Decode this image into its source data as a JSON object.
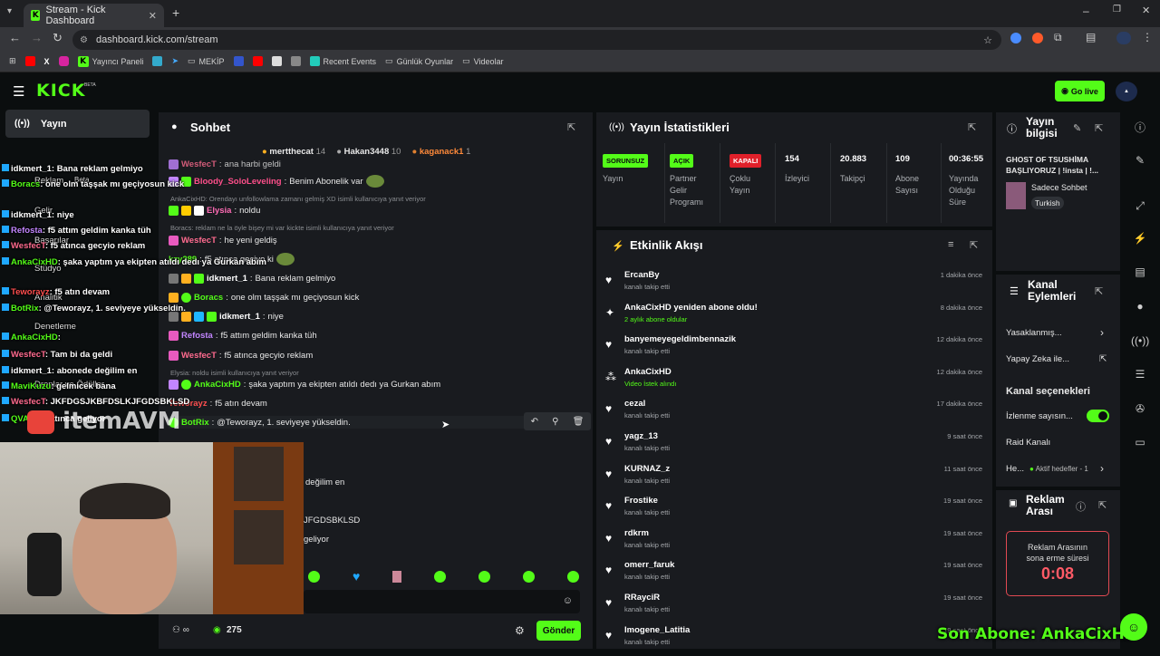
{
  "browser": {
    "tab_title": "Stream - Kick Dashboard",
    "url": "dashboard.kick.com/stream",
    "bookmarks": [
      "Yayıncı Paneli",
      "MEKİP",
      "Recent Events",
      "Günlük Oyunlar",
      "Videolar"
    ]
  },
  "header": {
    "logo": "KICK",
    "logo_badge": "BETA",
    "go_live": "Go live"
  },
  "left_nav": {
    "active_item": "Yayın"
  },
  "chat": {
    "title": "Sohbet",
    "top_gifters": [
      {
        "name": "mertthecat",
        "count": "14"
      },
      {
        "name": "Hakan3448",
        "count": "10"
      },
      {
        "name": "kaganack1",
        "count": "1"
      }
    ],
    "messages": [
      {
        "user": "WesfecT",
        "color": "#ff6b8f",
        "text": "ana harbi geldi"
      },
      {
        "user": "Bloody_SoloLeveling",
        "color": "#ff4f8b",
        "text": "Benim Abonelik var"
      },
      {
        "reply": "AnkaCixHD: Orendayı unfollowlama zamanı gelmiş XD isimli kullanıcıya yanıt veriyor"
      },
      {
        "user": "Elysia",
        "color": "#ff6bb5",
        "text": "noldu"
      },
      {
        "reply": "Boracs: reklam ne la öyle bişey mi var kickte isimli kullanıcıya yanıt veriyor"
      },
      {
        "user": "WesfecT",
        "color": "#ff6b8f",
        "text": "he yeni geldiş"
      },
      {
        "user": "kzy289",
        "color": "#53fc18",
        "text": "f5 atınca geçiyo ki"
      },
      {
        "user": "idkmert_1",
        "color": "#ffffff",
        "text": "Bana reklam gelmiyo"
      },
      {
        "user": "Boracs",
        "color": "#53fc18",
        "text": "one olm taşşak mı geçiyosun kick"
      },
      {
        "user": "idkmert_1",
        "color": "#ffffff",
        "text": "niye"
      },
      {
        "user": "Refosta",
        "color": "#c285ff",
        "text": "f5 attım geldim kanka tüh"
      },
      {
        "user": "WesfecT",
        "color": "#ff6b8f",
        "text": "f5 atınca gecyio reklam"
      },
      {
        "reply": "Elysia: noldu isimli kullanıcıya yanıt veriyor"
      },
      {
        "user": "AnkaCixHD",
        "color": "#53fc18",
        "text": "şaka yaptım ya ekipten atıldı dedı ya Gurkan abım"
      },
      {
        "user": "Teworayz",
        "color": "#ff4f4f",
        "text": "f5 atın devam"
      },
      {
        "user": "BotRix",
        "color": "#53fc18",
        "text": "@Teworayz, 1. seviyeye yükseldin."
      }
    ],
    "partial_messages": [
      "değilim en",
      "JFGDSBKLSD",
      "geliyor"
    ],
    "footer_count": "275",
    "send_label": "Gönder"
  },
  "stats": {
    "title": "Yayın İstatistikleri",
    "items": [
      {
        "pill": "SORUNSUZ",
        "pill_color": "#53fc18",
        "label": "Yayın"
      },
      {
        "pill": "AÇIK",
        "pill_color": "#53fc18",
        "label": "Partner Gelir Programı"
      },
      {
        "pill": "KAPALI",
        "pill_color": "#e0202a",
        "label": "Çoklu Yayın"
      },
      {
        "value": "154",
        "label": "İzleyici"
      },
      {
        "value": "20.883",
        "label": "Takipçi"
      },
      {
        "value": "109",
        "label": "Abone Sayısı"
      },
      {
        "value": "00:36:55",
        "label": "Yayında Olduğu Süre"
      }
    ]
  },
  "activity": {
    "title": "Etkinlik Akışı",
    "items": [
      {
        "name": "ErcanBy",
        "sub": "kanalı takip etti",
        "time": "1 dakika önce",
        "icon": "heart"
      },
      {
        "name": "AnkaCixHD yeniden abone oldu!",
        "sub": "2 aylık abone oldular",
        "time": "8 dakika önce",
        "icon": "star"
      },
      {
        "name": "banyemeyegeldimbennazik",
        "sub": "kanalı takip etti",
        "time": "12 dakika önce",
        "icon": "heart"
      },
      {
        "name": "AnkaCixHD",
        "sub": "Video İstek alındı",
        "time": "12 dakika önce",
        "icon": "dots"
      },
      {
        "name": "cezal",
        "sub": "kanalı takip etti",
        "time": "17 dakika önce",
        "icon": "heart"
      },
      {
        "name": "yagz_13",
        "sub": "kanalı takip etti",
        "time": "9 saat önce",
        "icon": "heart"
      },
      {
        "name": "KURNAZ_z",
        "sub": "kanalı takip etti",
        "time": "11 saat önce",
        "icon": "heart"
      },
      {
        "name": "Frostike",
        "sub": "kanalı takip etti",
        "time": "19 saat önce",
        "icon": "heart"
      },
      {
        "name": "rdkrm",
        "sub": "kanalı takip etti",
        "time": "19 saat önce",
        "icon": "heart"
      },
      {
        "name": "omerr_faruk",
        "sub": "kanalı takip etti",
        "time": "19 saat önce",
        "icon": "heart"
      },
      {
        "name": "RRayciR",
        "sub": "kanalı takip etti",
        "time": "19 saat önce",
        "icon": "heart"
      },
      {
        "name": "Imogene_Latitia",
        "sub": "kanalı takip etti",
        "time": "19 saat önce",
        "icon": "heart"
      }
    ]
  },
  "stream_info": {
    "title": "Yayın bilgisi",
    "stream_title": "GHOST OF TSUSHİMA BAŞLIYORUZ | !insta | !...",
    "category": "Sadece Sohbet",
    "language": "Turkish"
  },
  "channel_actions": {
    "title": "Kanal Eylemleri",
    "items": [
      "Yasaklanmış...",
      "Yapay Zeka ile..."
    ],
    "options_title": "Kanal seçenekleri",
    "viewer_count_label": "İzlenme sayısın...",
    "raid_label": "Raid Kanalı",
    "goals_label": "He...",
    "goals_status": "Aktif hedefler - 1"
  },
  "ad_break": {
    "title": "Reklam Arası",
    "countdown_label": "Reklam Arasının sona erme süresi",
    "countdown": "0:08"
  },
  "overlay": {
    "last_sub": "Son Abone: AnkaCixHD",
    "chat": [
      {
        "user": "idkmert_1",
        "color": "#ffffff",
        "text": ": Bana reklam gelmiyo"
      },
      {
        "user": "Boracs",
        "color": "#53fc18",
        "text": ": one olm taşşak mı geçiyosun kick"
      },
      {
        "user": "idkmert_1",
        "color": "#ffffff",
        "text": ": niye"
      },
      {
        "user": "Refosta",
        "color": "#c285ff",
        "text": ": f5 attım geldim kanka tüh"
      },
      {
        "user": "WesfecT",
        "color": "#ff6b8f",
        "text": ": f5 atınca gecyio reklam"
      },
      {
        "user": "AnkaCixHD",
        "color": "#53fc18",
        "text": ": şaka yaptım ya ekipten atıldı dedı ya Gurkan abım"
      },
      {
        "user": "Teworayz",
        "color": "#ff4f4f",
        "text": ": f5 atın devam"
      },
      {
        "user": "BotRix",
        "color": "#53fc18",
        "text": ": @Teworayz, 1. seviyeye yükseldin."
      },
      {
        "user": "AnkaCixHD",
        "color": "#53fc18",
        "text": ":"
      },
      {
        "user": "WesfecT",
        "color": "#ff6b8f",
        "text": ": Tam bi da geldi"
      },
      {
        "user": "idkmert_1",
        "color": "#ffffff",
        "text": ": abonede değilim en"
      },
      {
        "user": "MaviKuzu",
        "color": "#53fc18",
        "text": ": gelmicek bana"
      },
      {
        "user": "WesfecT",
        "color": "#ff6b8f",
        "text": ": JKFDGSJKBFDSLKJFGDSBKLSD"
      },
      {
        "user": "QVAE",
        "color": "#53fc18",
        "text": ": f5 atınca geliyor"
      }
    ],
    "left_nav_labels": [
      "Reklam",
      "Gelir",
      "Başarılar",
      "Stüdyo",
      "Analitik",
      "Denetleme",
      "Dronlar ve Ödüller"
    ],
    "beta": "Beta",
    "brand": "itemAVM"
  }
}
